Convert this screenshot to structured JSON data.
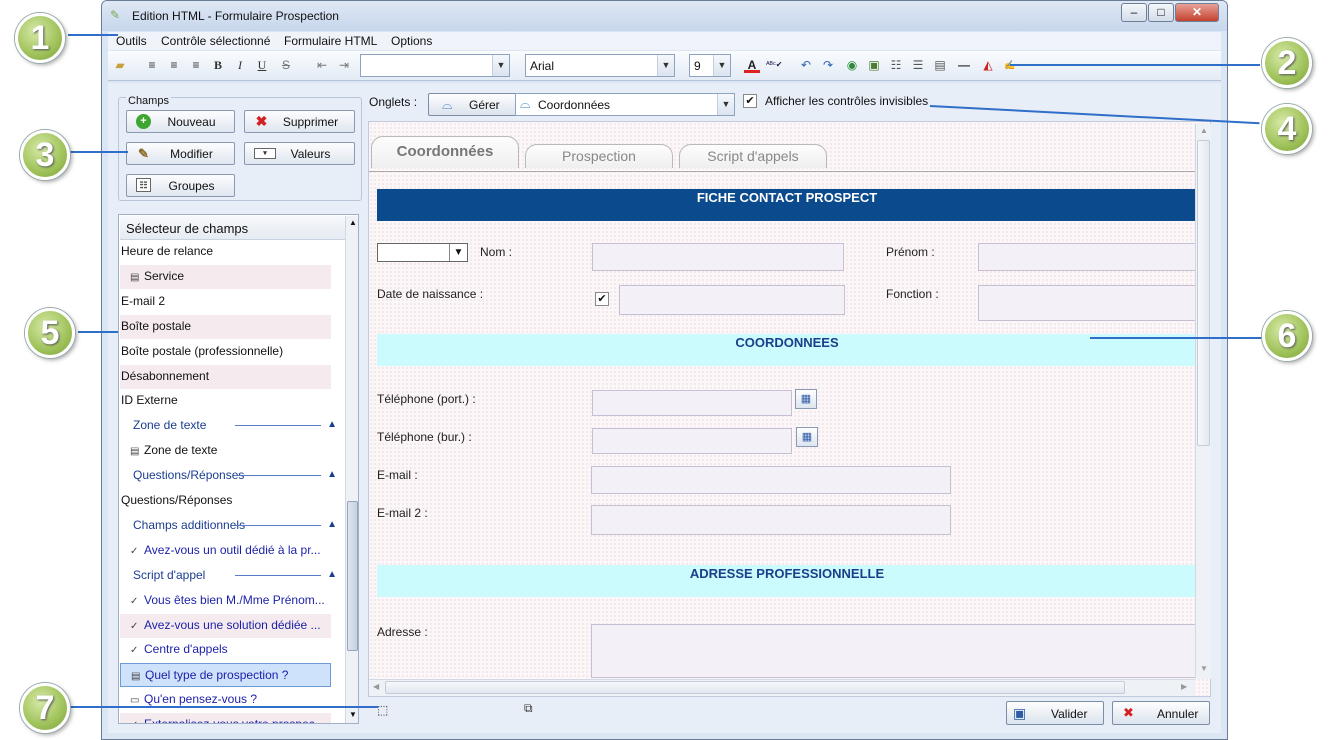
{
  "window": {
    "title": "Edition HTML - Formulaire Prospection",
    "controls": {
      "minimize": "–",
      "maximize": "□",
      "close": "✕"
    }
  },
  "menu": [
    "Outils",
    "Contrôle sélectionné",
    "Formulaire HTML",
    "Options"
  ],
  "toolbar": {
    "font_family": "Arial",
    "font_size": "9",
    "style_buttons": [
      "B",
      "I",
      "U",
      "S"
    ]
  },
  "champs": {
    "group_title": "Champs",
    "nouveau": "Nouveau",
    "supprimer": "Supprimer",
    "modifier": "Modifier",
    "valeurs": "Valeurs",
    "groupes": "Groupes"
  },
  "selector": {
    "title": "Sélecteur de champs",
    "items": [
      {
        "label": "Heure de relance",
        "type": "plain"
      },
      {
        "label": "Service",
        "type": "icon"
      },
      {
        "label": "E-mail 2",
        "type": "plain"
      },
      {
        "label": "Boîte postale",
        "type": "plain"
      },
      {
        "label": "Boîte postale (professionnelle)",
        "type": "plain"
      },
      {
        "label": "Désabonnement",
        "type": "plain"
      },
      {
        "label": "ID Externe",
        "type": "plain"
      },
      {
        "label": "Zone de texte",
        "type": "section"
      },
      {
        "label": "Zone de texte",
        "type": "icon"
      },
      {
        "label": "Questions/Réponses",
        "type": "section"
      },
      {
        "label": "Questions/Réponses",
        "type": "plain"
      },
      {
        "label": "Champs additionnels",
        "type": "section"
      },
      {
        "label": "Avez-vous un outil dédié à la pr...",
        "type": "link"
      },
      {
        "label": "Script d'appel",
        "type": "section"
      },
      {
        "label": "Vous êtes bien M./Mme Prénom...",
        "type": "link"
      },
      {
        "label": "Avez-vous une solution dédiée ...",
        "type": "link"
      },
      {
        "label": "Centre d'appels",
        "type": "link"
      },
      {
        "label": "Quel type de prospection ?",
        "type": "selected"
      },
      {
        "label": "Qu'en pensez-vous ?",
        "type": "link"
      },
      {
        "label": "Externalisez-vous votre prospec...",
        "type": "link"
      }
    ]
  },
  "onglets": {
    "label": "Onglets :",
    "gerer": "Gérer",
    "selected": "Coordonnées",
    "show_invisible": "Afficher les contrôles invisibles",
    "show_invisible_checked": true
  },
  "tabs": [
    "Coordonnées",
    "Prospection",
    "Script d'appels"
  ],
  "form": {
    "header": "FICHE CONTACT PROSPECT",
    "nom": "Nom :",
    "prenom": "Prénom :",
    "date_naissance": "Date de naissance :",
    "fonction": "Fonction :",
    "coordonnees": "COORDONNEES",
    "tel_port": "Téléphone (port.) :",
    "tel_bur": "Téléphone (bur.) :",
    "email": "E-mail :",
    "email2": "E-mail 2 :",
    "adresse_pro": "ADRESSE PROFESSIONNELLE",
    "adresse": "Adresse  :"
  },
  "buttons": {
    "valider": "Valider",
    "annuler": "Annuler"
  },
  "callouts": [
    "1",
    "2",
    "3",
    "4",
    "5",
    "6",
    "7"
  ],
  "colors": {
    "header_band": "#0b4a8c",
    "section_band": "#ccfbfd",
    "callout": "#9fc25a"
  }
}
